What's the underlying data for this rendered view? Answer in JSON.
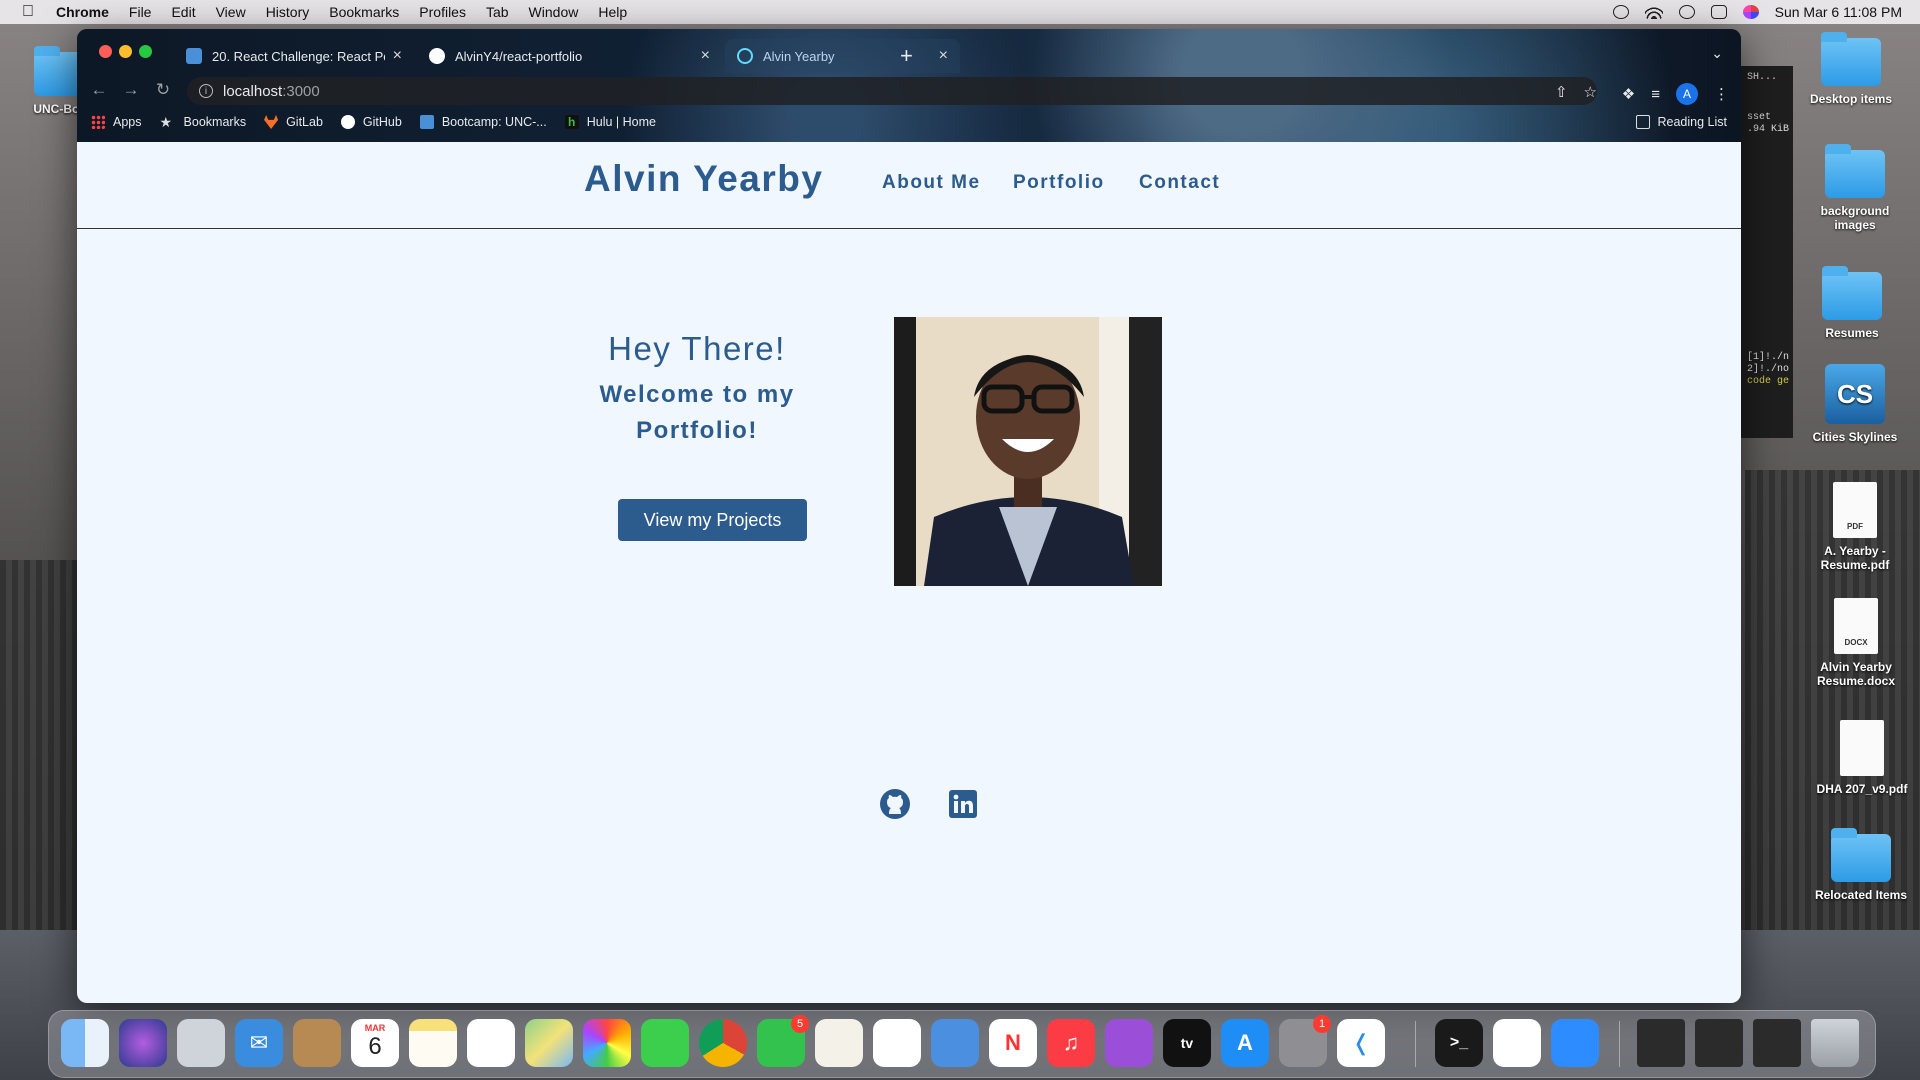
{
  "menubar": {
    "app_name": "Chrome",
    "items": [
      "File",
      "Edit",
      "View",
      "History",
      "Bookmarks",
      "Profiles",
      "Tab",
      "Window",
      "Help"
    ],
    "clock": "Sun Mar 6  11:08 PM"
  },
  "browser": {
    "tabs": [
      {
        "label": "20. React Challenge: React Por",
        "icon": "doc-icon"
      },
      {
        "label": "AlvinY4/react-portfolio",
        "icon": "github-icon"
      },
      {
        "label": "Alvin Yearby",
        "icon": "react-icon",
        "active": true
      }
    ],
    "url": {
      "host": "localhost",
      "port": ":3000"
    },
    "profile_initial": "A",
    "bookmarks": [
      "Apps",
      "Bookmarks",
      "GitLab",
      "GitHub",
      "Bootcamp: UNC-...",
      "Hulu | Home"
    ],
    "reading_list": "Reading List"
  },
  "site": {
    "brand": "Alvin Yearby",
    "nav": {
      "about": "About Me",
      "portfolio": "Portfolio",
      "contact": "Contact"
    },
    "hero": {
      "greeting": "Hey There!",
      "welcome": "Welcome to my Portfolio!",
      "cta": "View my Projects"
    },
    "social": [
      "github-icon",
      "linkedin-icon"
    ],
    "colors": {
      "primary": "#2c5b8e",
      "background": "#f0f7fe"
    }
  },
  "desktop": {
    "left_item": "UNC-Boo",
    "items": [
      {
        "label": "Desktop items",
        "kind": "folder"
      },
      {
        "label": "background images",
        "kind": "folder"
      },
      {
        "label": "Resumes",
        "kind": "folder"
      },
      {
        "label": "Cities Skylines",
        "kind": "app"
      },
      {
        "label": "A. Yearby - Resume.pdf",
        "kind": "pdf",
        "tag": "PDF"
      },
      {
        "label": "Alvin Yearby Resume.docx",
        "kind": "docx",
        "tag": "DOCX"
      },
      {
        "label": "DHA 207_v9.pdf",
        "kind": "pdf",
        "tag": ""
      },
      {
        "label": "Relocated Items",
        "kind": "folder"
      }
    ],
    "terminal_snippet": [
      "SH...",
      "sset",
      ".94 KiB",
      "[1]!./n",
      "2]!./no",
      "code ge"
    ]
  },
  "dock": {
    "calendar_month": "MAR",
    "calendar_day": "6",
    "badges": {
      "facetime": "5",
      "settings": "1"
    }
  }
}
